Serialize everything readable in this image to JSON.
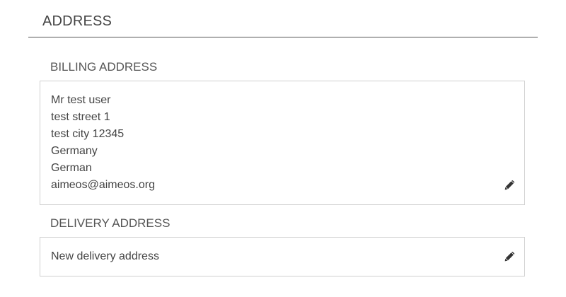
{
  "section": {
    "title": "ADDRESS"
  },
  "billing": {
    "title": "BILLING ADDRESS",
    "lines": [
      "Mr test user",
      "test street 1",
      "test city 12345",
      "Germany",
      "German",
      "aimeos@aimeos.org"
    ],
    "edit_icon": "pencil-icon"
  },
  "delivery": {
    "title": "DELIVERY ADDRESS",
    "text": "New delivery address",
    "edit_icon": "pencil-icon"
  },
  "colors": {
    "text": "#444444",
    "border": "#d0d0d0",
    "rule": "#555555"
  }
}
